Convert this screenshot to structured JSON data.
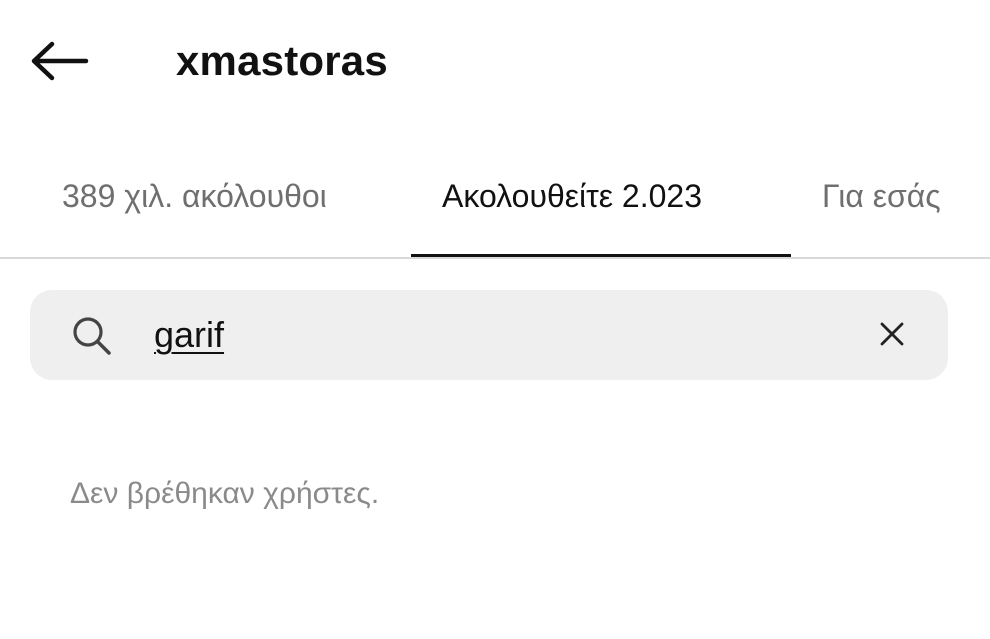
{
  "header": {
    "back_icon": "arrow-left-icon",
    "username": "xmastoras"
  },
  "tabs": [
    {
      "label": "389 χιλ. ακόλουθοι",
      "active": false
    },
    {
      "label": "Ακολουθείτε 2.023",
      "active": true
    },
    {
      "label": "Για εσάς",
      "active": false
    }
  ],
  "search": {
    "icon": "search-icon",
    "value": "garif",
    "clear_icon": "close-icon"
  },
  "results": {
    "empty_message": "Δεν βρέθηκαν χρήστες."
  },
  "colors": {
    "background": "#ffffff",
    "search_background": "#efefef",
    "active_text": "#111111",
    "inactive_text": "#6f6f6f",
    "muted_text": "#8a8a8a"
  }
}
